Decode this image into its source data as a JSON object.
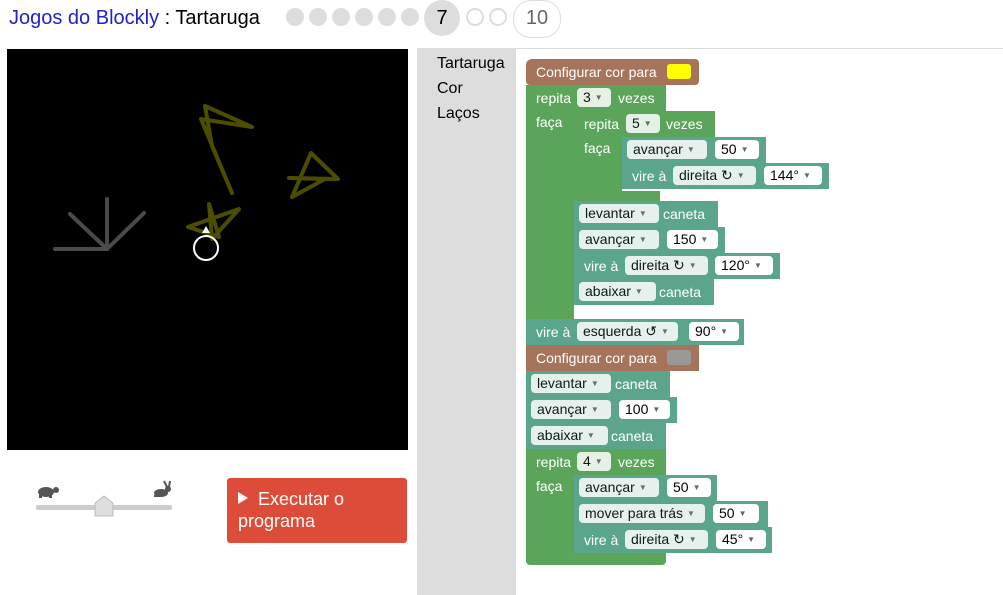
{
  "header": {
    "app_link": "Jogos do Blockly",
    "separator": " : ",
    "game_name": "Tartaruga",
    "current_level": "7",
    "last_level": "10"
  },
  "controls": {
    "run_button": "Executar o programa",
    "slow_icon": "turtle-icon",
    "fast_icon": "rabbit-icon",
    "speed": 0.5
  },
  "toolbox": {
    "categories": [
      "Tartaruga",
      "Cor",
      "Laços"
    ]
  },
  "colors": {
    "colour_block": "#a5745b",
    "loop_block": "#5ba55b",
    "turtle_block": "#5ba58c",
    "run_button": "#dd4b39",
    "swatch_yellow": "#ffff00",
    "swatch_grey": "#999999",
    "star_stroke": "#4d4d00",
    "trail_stroke": "#4a4a4a"
  },
  "blocks": {
    "set_colour_label": "Configurar cor para",
    "repeat_label": "repita",
    "times_label": "vezes",
    "do_label": "faça",
    "repeat_outer_count": "3",
    "repeat_inner_count": "5",
    "forward_label": "avançar",
    "forward_50": "50",
    "turn_label": "vire à",
    "right_option": "direita ↻",
    "left_option": "esquerda ↺",
    "angle_144": "144°",
    "penup_option": "levantar",
    "pen_label": "caneta",
    "forward_150": "150",
    "angle_120": "120°",
    "pendown_option": "abaixar",
    "angle_90": "90°",
    "forward_100": "100",
    "repeat_last_count": "4",
    "backward_option": "mover para trás",
    "backward_50": "50",
    "angle_45": "45°"
  }
}
